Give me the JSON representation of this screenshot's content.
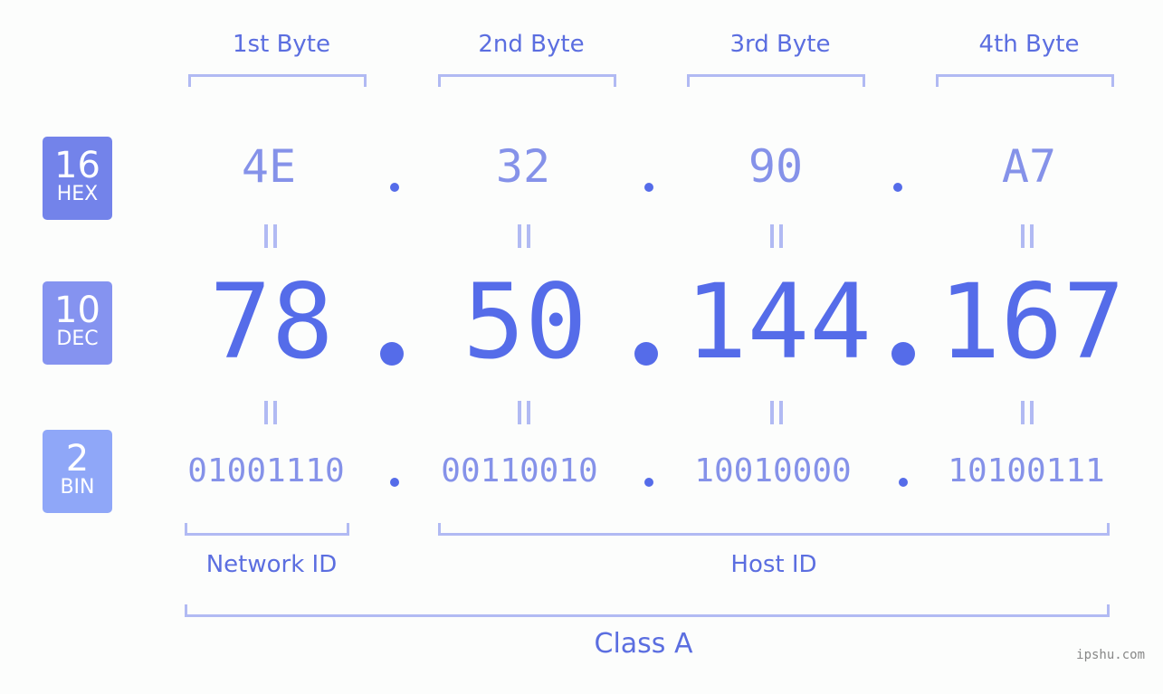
{
  "bytes": [
    {
      "label": "1st Byte",
      "hex": "4E",
      "dec": "78",
      "bin": "01001110"
    },
    {
      "label": "2nd Byte",
      "hex": "32",
      "dec": "50",
      "bin": "00110010"
    },
    {
      "label": "3rd Byte",
      "hex": "90",
      "dec": "144",
      "bin": "10010000"
    },
    {
      "label": "4th Byte",
      "hex": "A7",
      "dec": "167",
      "bin": "10100111"
    }
  ],
  "badges": {
    "hex": {
      "num": "16",
      "label": "HEX",
      "color": "#7383ea"
    },
    "dec": {
      "num": "10",
      "label": "DEC",
      "color": "#8593f0"
    },
    "bin": {
      "num": "2",
      "label": "BIN",
      "color": "#8fa7f8"
    }
  },
  "sections": {
    "network": "Network ID",
    "host": "Host ID",
    "class": "Class A"
  },
  "watermark": "ipshu.com",
  "colors": {
    "accent": "#556ce9",
    "light": "#8592e9",
    "bracket": "#b1baf3"
  }
}
